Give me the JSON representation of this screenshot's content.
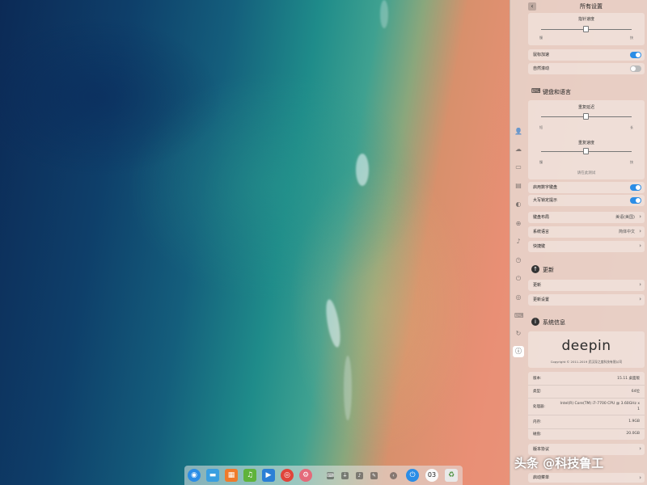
{
  "panel": {
    "title": "所有设置",
    "mouse": {
      "pointer_speed": {
        "label": "指针速度",
        "min": "慢",
        "max": "快",
        "value": 0.5
      },
      "mouse_accel": {
        "label": "鼠标加速",
        "on": true
      },
      "natural_scroll": {
        "label": "自然滚动",
        "on": false
      }
    },
    "keyboard": {
      "section_title": "键盘和语言",
      "repeat_delay": {
        "label": "重复延迟",
        "min": "短",
        "max": "长",
        "value": 0.5
      },
      "repeat_rate": {
        "label": "重复速度",
        "min": "慢",
        "max": "快",
        "value": 0.5
      },
      "test_note": "请在此测试",
      "numlock": {
        "label": "启用数字键盘",
        "on": true
      },
      "capslock": {
        "label": "大写锁定提示",
        "on": true
      },
      "layout": {
        "label": "键盘布局",
        "value": "美语(美国)"
      },
      "lang": {
        "label": "系统语言",
        "value": "简体中文"
      },
      "shortcuts": {
        "label": "快捷键"
      }
    },
    "update": {
      "section_title": "更新",
      "update_label": "更新",
      "settings_label": "更新设置"
    },
    "sysinfo": {
      "section_title": "系统信息",
      "logo": "deepin",
      "copyright": "Copyright © 2011-2019 武汉深之度科技有限公司",
      "rows": [
        {
          "label": "版本:",
          "value": "15.11 桌面版"
        },
        {
          "label": "类型:",
          "value": "64位"
        },
        {
          "label": "处理器:",
          "value": "Intel(R) Core(TM) i7-7700 CPU @ 3.60GHz x 1"
        },
        {
          "label": "内存:",
          "value": "1.9GB"
        },
        {
          "label": "磁盘:",
          "value": "20.0GB"
        }
      ],
      "license": "版本协议",
      "boot": "启动菜单"
    }
  },
  "sidebar": {
    "icons": [
      "account-icon",
      "cloud-icon",
      "display-icon",
      "default-apps-icon",
      "personalization-icon",
      "network-icon",
      "sound-icon",
      "time-icon",
      "power-icon",
      "mouse-icon",
      "keyboard-icon",
      "update-icon",
      "info-icon"
    ]
  },
  "dock": {
    "apps": [
      {
        "name": "launcher-icon",
        "color": "#2b8de6"
      },
      {
        "name": "file-manager-icon",
        "color": "#3a9fe0"
      },
      {
        "name": "app-store-icon",
        "color": "#f07b2b"
      },
      {
        "name": "music-icon",
        "color": "#5fb33b"
      },
      {
        "name": "movie-icon",
        "color": "#2b7fd6"
      },
      {
        "name": "browser-icon",
        "color": "#e0443a"
      },
      {
        "name": "settings-icon",
        "color": "#e46a7a"
      }
    ],
    "time": "03"
  },
  "watermark": "头条 @科技鲁工"
}
